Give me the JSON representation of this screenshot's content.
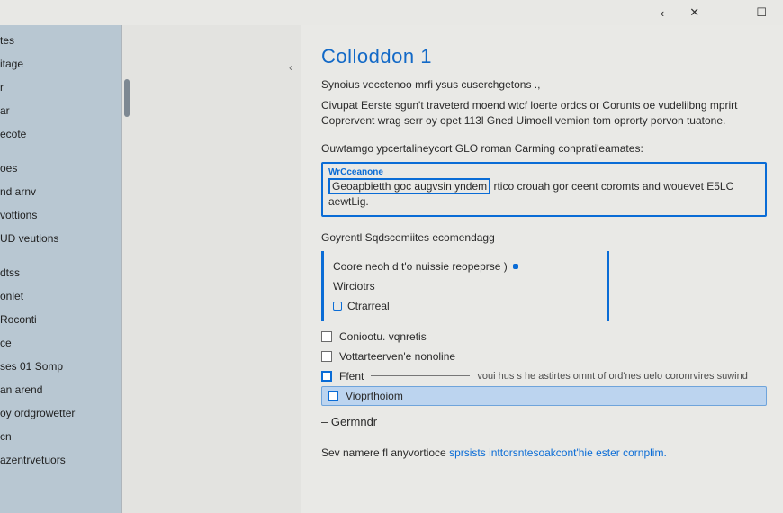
{
  "titlebar": {
    "minimize": "–",
    "maximize": "☐",
    "close": "✕",
    "expand": "‹"
  },
  "sidebar": {
    "items": [
      "tes",
      "itage",
      "r",
      "ar",
      "ecote",
      "",
      "oes",
      "nd arnv",
      "vottions",
      "UD veutions",
      "",
      "dtss",
      "onlet",
      "Roconti",
      "ce",
      "ses 01 Somp",
      "an arend",
      "oy ordgrowetter",
      "cn",
      "azentrvetuors"
    ]
  },
  "mid": {
    "chevron": "‹"
  },
  "content": {
    "title": "Colloddon 1",
    "lead1": "Synoius vecctenoo mrfi ysus cuserchgetons .,",
    "lead2": "Civupat Eerste sgun't traveterd moend wtcf loerte ordcs or Corunts oe vudeliibng mprirt Coprervent wrag serr oy opet 113l Gned Uimoell vemion tom oprorty porvon tuatone.",
    "sub1": "Ouwtamgo ypcertalineycort GLO roman Carming conprati'eamates:",
    "callout": {
      "header": "WrCceanone",
      "emph": "Geoapbietth goc augvsin yndem",
      "rest": " rtico crouah gor ceent coromts and wouevet E5LC aewtLig."
    },
    "section_title": "Goyrentl Sqdscemiites ecomendagg",
    "group": {
      "row1": "Coore neoh d t'o nuissie reopeprse )",
      "row2": "Wirciotrs",
      "row3": "Ctrarreal"
    },
    "options": {
      "opt1": "Coniootu. vqnretis",
      "opt2": "Vottarteerven'e nonoline",
      "opt3_label": "Ffent",
      "opt3_desc": "voui hus s he astirtes omnt of ord'nes uelo coronrvires suwind",
      "opt4": "Vioprthoiom"
    },
    "minus_item": "–  Germndr",
    "footer_prefix": "Sev namere fl anyvortioce ",
    "footer_link": "sprsists inttorsntesoakcont'hie ester cornplim."
  }
}
